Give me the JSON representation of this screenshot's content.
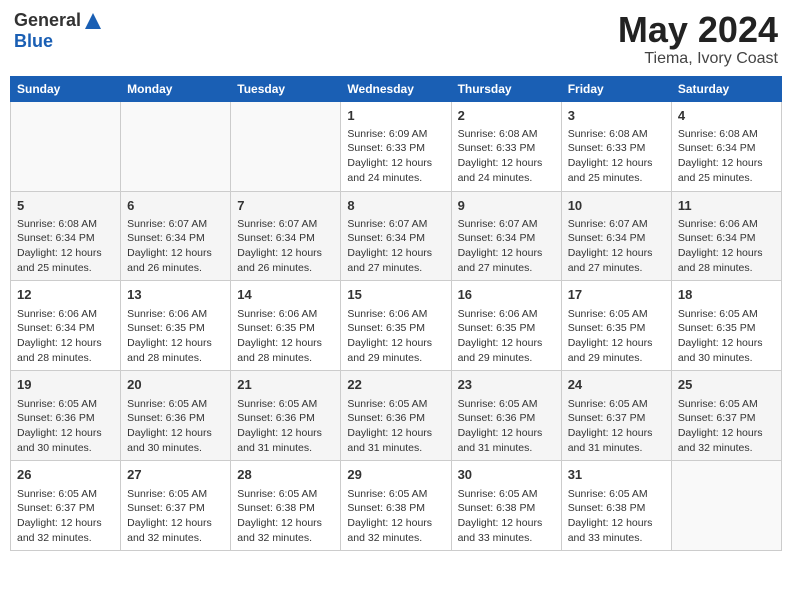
{
  "header": {
    "logo_general": "General",
    "logo_blue": "Blue",
    "month_title": "May 2024",
    "location": "Tiema, Ivory Coast"
  },
  "days_of_week": [
    "Sunday",
    "Monday",
    "Tuesday",
    "Wednesday",
    "Thursday",
    "Friday",
    "Saturday"
  ],
  "weeks": [
    {
      "cells": [
        {
          "day": "",
          "sunrise": "",
          "sunset": "",
          "daylight": "",
          "empty": true
        },
        {
          "day": "",
          "sunrise": "",
          "sunset": "",
          "daylight": "",
          "empty": true
        },
        {
          "day": "",
          "sunrise": "",
          "sunset": "",
          "daylight": "",
          "empty": true
        },
        {
          "day": "1",
          "sunrise": "Sunrise: 6:09 AM",
          "sunset": "Sunset: 6:33 PM",
          "daylight": "Daylight: 12 hours and 24 minutes."
        },
        {
          "day": "2",
          "sunrise": "Sunrise: 6:08 AM",
          "sunset": "Sunset: 6:33 PM",
          "daylight": "Daylight: 12 hours and 24 minutes."
        },
        {
          "day": "3",
          "sunrise": "Sunrise: 6:08 AM",
          "sunset": "Sunset: 6:33 PM",
          "daylight": "Daylight: 12 hours and 25 minutes."
        },
        {
          "day": "4",
          "sunrise": "Sunrise: 6:08 AM",
          "sunset": "Sunset: 6:34 PM",
          "daylight": "Daylight: 12 hours and 25 minutes."
        }
      ]
    },
    {
      "cells": [
        {
          "day": "5",
          "sunrise": "Sunrise: 6:08 AM",
          "sunset": "Sunset: 6:34 PM",
          "daylight": "Daylight: 12 hours and 25 minutes."
        },
        {
          "day": "6",
          "sunrise": "Sunrise: 6:07 AM",
          "sunset": "Sunset: 6:34 PM",
          "daylight": "Daylight: 12 hours and 26 minutes."
        },
        {
          "day": "7",
          "sunrise": "Sunrise: 6:07 AM",
          "sunset": "Sunset: 6:34 PM",
          "daylight": "Daylight: 12 hours and 26 minutes."
        },
        {
          "day": "8",
          "sunrise": "Sunrise: 6:07 AM",
          "sunset": "Sunset: 6:34 PM",
          "daylight": "Daylight: 12 hours and 27 minutes."
        },
        {
          "day": "9",
          "sunrise": "Sunrise: 6:07 AM",
          "sunset": "Sunset: 6:34 PM",
          "daylight": "Daylight: 12 hours and 27 minutes."
        },
        {
          "day": "10",
          "sunrise": "Sunrise: 6:07 AM",
          "sunset": "Sunset: 6:34 PM",
          "daylight": "Daylight: 12 hours and 27 minutes."
        },
        {
          "day": "11",
          "sunrise": "Sunrise: 6:06 AM",
          "sunset": "Sunset: 6:34 PM",
          "daylight": "Daylight: 12 hours and 28 minutes."
        }
      ]
    },
    {
      "cells": [
        {
          "day": "12",
          "sunrise": "Sunrise: 6:06 AM",
          "sunset": "Sunset: 6:34 PM",
          "daylight": "Daylight: 12 hours and 28 minutes."
        },
        {
          "day": "13",
          "sunrise": "Sunrise: 6:06 AM",
          "sunset": "Sunset: 6:35 PM",
          "daylight": "Daylight: 12 hours and 28 minutes."
        },
        {
          "day": "14",
          "sunrise": "Sunrise: 6:06 AM",
          "sunset": "Sunset: 6:35 PM",
          "daylight": "Daylight: 12 hours and 28 minutes."
        },
        {
          "day": "15",
          "sunrise": "Sunrise: 6:06 AM",
          "sunset": "Sunset: 6:35 PM",
          "daylight": "Daylight: 12 hours and 29 minutes."
        },
        {
          "day": "16",
          "sunrise": "Sunrise: 6:06 AM",
          "sunset": "Sunset: 6:35 PM",
          "daylight": "Daylight: 12 hours and 29 minutes."
        },
        {
          "day": "17",
          "sunrise": "Sunrise: 6:05 AM",
          "sunset": "Sunset: 6:35 PM",
          "daylight": "Daylight: 12 hours and 29 minutes."
        },
        {
          "day": "18",
          "sunrise": "Sunrise: 6:05 AM",
          "sunset": "Sunset: 6:35 PM",
          "daylight": "Daylight: 12 hours and 30 minutes."
        }
      ]
    },
    {
      "cells": [
        {
          "day": "19",
          "sunrise": "Sunrise: 6:05 AM",
          "sunset": "Sunset: 6:36 PM",
          "daylight": "Daylight: 12 hours and 30 minutes."
        },
        {
          "day": "20",
          "sunrise": "Sunrise: 6:05 AM",
          "sunset": "Sunset: 6:36 PM",
          "daylight": "Daylight: 12 hours and 30 minutes."
        },
        {
          "day": "21",
          "sunrise": "Sunrise: 6:05 AM",
          "sunset": "Sunset: 6:36 PM",
          "daylight": "Daylight: 12 hours and 31 minutes."
        },
        {
          "day": "22",
          "sunrise": "Sunrise: 6:05 AM",
          "sunset": "Sunset: 6:36 PM",
          "daylight": "Daylight: 12 hours and 31 minutes."
        },
        {
          "day": "23",
          "sunrise": "Sunrise: 6:05 AM",
          "sunset": "Sunset: 6:36 PM",
          "daylight": "Daylight: 12 hours and 31 minutes."
        },
        {
          "day": "24",
          "sunrise": "Sunrise: 6:05 AM",
          "sunset": "Sunset: 6:37 PM",
          "daylight": "Daylight: 12 hours and 31 minutes."
        },
        {
          "day": "25",
          "sunrise": "Sunrise: 6:05 AM",
          "sunset": "Sunset: 6:37 PM",
          "daylight": "Daylight: 12 hours and 32 minutes."
        }
      ]
    },
    {
      "cells": [
        {
          "day": "26",
          "sunrise": "Sunrise: 6:05 AM",
          "sunset": "Sunset: 6:37 PM",
          "daylight": "Daylight: 12 hours and 32 minutes."
        },
        {
          "day": "27",
          "sunrise": "Sunrise: 6:05 AM",
          "sunset": "Sunset: 6:37 PM",
          "daylight": "Daylight: 12 hours and 32 minutes."
        },
        {
          "day": "28",
          "sunrise": "Sunrise: 6:05 AM",
          "sunset": "Sunset: 6:38 PM",
          "daylight": "Daylight: 12 hours and 32 minutes."
        },
        {
          "day": "29",
          "sunrise": "Sunrise: 6:05 AM",
          "sunset": "Sunset: 6:38 PM",
          "daylight": "Daylight: 12 hours and 32 minutes."
        },
        {
          "day": "30",
          "sunrise": "Sunrise: 6:05 AM",
          "sunset": "Sunset: 6:38 PM",
          "daylight": "Daylight: 12 hours and 33 minutes."
        },
        {
          "day": "31",
          "sunrise": "Sunrise: 6:05 AM",
          "sunset": "Sunset: 6:38 PM",
          "daylight": "Daylight: 12 hours and 33 minutes."
        },
        {
          "day": "",
          "sunrise": "",
          "sunset": "",
          "daylight": "",
          "empty": true
        }
      ]
    }
  ]
}
